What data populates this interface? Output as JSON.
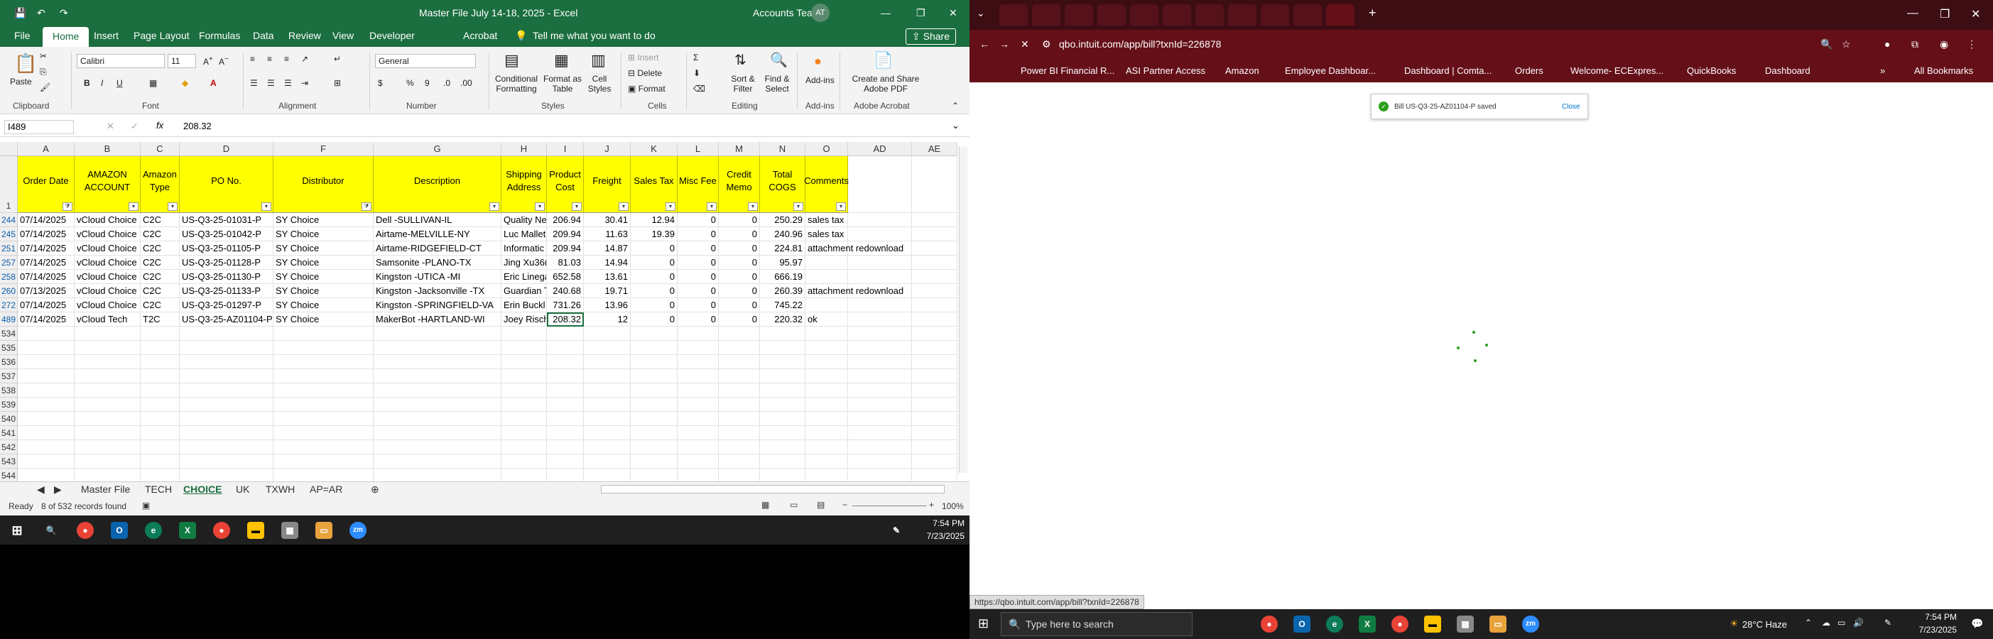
{
  "excel": {
    "title": "Master File July 14-18, 2025  -  Excel",
    "account_name": "Accounts Team",
    "account_initials": "AT",
    "menu_tabs": [
      "File",
      "Home",
      "Insert",
      "Page Layout",
      "Formulas",
      "Data",
      "Review",
      "View",
      "Developer",
      "Acrobat"
    ],
    "active_tab": "Home",
    "tell_me": "Tell me what you want to do",
    "share": "Share",
    "ribbon": {
      "paste": "Paste",
      "font_name": "Calibri",
      "font_size": "11",
      "number_format": "General",
      "conditional_formatting": "Conditional Formatting",
      "format_as_table": "Format as Table",
      "cell_styles": "Cell Styles",
      "insert": "Insert",
      "delete": "Delete",
      "format": "Format",
      "sort_filter": "Sort & Filter",
      "find_select": "Find & Select",
      "add_ins": "Add-ins",
      "create_share": "Create and Share Adobe PDF",
      "groups": [
        "Clipboard",
        "Font",
        "Alignment",
        "Number",
        "Styles",
        "Cells",
        "Editing",
        "Add-ins",
        "Adobe Acrobat"
      ]
    },
    "name_box": "I489",
    "formula_value": "208.32",
    "columns": [
      "A",
      "B",
      "C",
      "D",
      "F",
      "G",
      "H",
      "I",
      "J",
      "K",
      "L",
      "M",
      "N",
      "O",
      "AD",
      "AE"
    ],
    "headers": [
      "Order Date",
      "AMAZON ACCOUNT",
      "Amazon Type",
      "PO No.",
      "Distributor",
      "Description",
      "Shipping Address",
      "Product Cost",
      "Freight",
      "Sales Tax",
      "Misc Fee",
      "Credit Memo",
      "Total COGS",
      "Comments"
    ],
    "rows": [
      {
        "num": "244",
        "cells": [
          "07/14/2025",
          "vCloud Choice",
          "C2C",
          "US-Q3-25-01031-P",
          "SY Choice",
          "Dell -SULLIVAN-IL",
          "Quality Ne",
          "206.94",
          "30.41",
          "12.94",
          "0",
          "0",
          "250.29",
          "sales tax"
        ]
      },
      {
        "num": "245",
        "cells": [
          "07/14/2025",
          "vCloud Choice",
          "C2C",
          "US-Q3-25-01042-P",
          "SY Choice",
          "Airtame-MELVILLE-NY",
          "Luc Mallet",
          "209.94",
          "11.63",
          "19.39",
          "0",
          "0",
          "240.96",
          "sales tax"
        ]
      },
      {
        "num": "251",
        "cells": [
          "07/14/2025",
          "vCloud Choice",
          "C2C",
          "US-Q3-25-01105-P",
          "SY Choice",
          "Airtame-RIDGEFIELD-CT",
          "Informatic",
          "209.94",
          "14.87",
          "0",
          "0",
          "0",
          "224.81",
          "attachment redownload"
        ]
      },
      {
        "num": "257",
        "cells": [
          "07/14/2025",
          "vCloud Choice",
          "C2C",
          "US-Q3-25-01128-P",
          "SY Choice",
          "Samsonite -PLANO-TX",
          "Jing Xu36(",
          "81.03",
          "14.94",
          "0",
          "0",
          "0",
          "95.97",
          ""
        ]
      },
      {
        "num": "258",
        "cells": [
          "07/14/2025",
          "vCloud Choice",
          "C2C",
          "US-Q3-25-01130-P",
          "SY Choice",
          "Kingston -UTICA -MI",
          "Eric Linega",
          "652.58",
          "13.61",
          "0",
          "0",
          "0",
          "666.19",
          ""
        ]
      },
      {
        "num": "260",
        "cells": [
          "07/13/2025",
          "vCloud Choice",
          "C2C",
          "US-Q3-25-01133-P",
          "SY Choice",
          "Kingston -Jacksonville -TX",
          "Guardian T",
          "240.68",
          "19.71",
          "0",
          "0",
          "0",
          "260.39",
          "attachment redownload"
        ]
      },
      {
        "num": "272",
        "cells": [
          "07/14/2025",
          "vCloud Choice",
          "C2C",
          "US-Q3-25-01297-P",
          "SY Choice",
          "Kingston -SPRINGFIELD-VA",
          "Erin Buckl",
          "731.26",
          "13.96",
          "0",
          "0",
          "0",
          "745.22",
          ""
        ]
      },
      {
        "num": "489",
        "cells": [
          "07/14/2025",
          "vCloud Tech",
          "T2C",
          "US-Q3-25-AZ01104-P",
          "SY Choice",
          "MakerBot -HARTLAND-WI",
          "Joey Risch",
          "208.32",
          "12",
          "0",
          "0",
          "0",
          "220.32",
          "ok"
        ]
      }
    ],
    "empty_rows": [
      "534",
      "535",
      "536",
      "537",
      "538",
      "539",
      "540",
      "541",
      "542",
      "543",
      "544"
    ],
    "sheet_tabs": [
      "Master File",
      "TECH",
      "CHOICE",
      "UK",
      "TXWH",
      "AP=AR"
    ],
    "active_sheet": "CHOICE",
    "status_ready": "Ready",
    "status_records": "8 of 532 records found",
    "zoom": "100%",
    "taskbar_time": "7:54 PM",
    "taskbar_date": "7/23/2025"
  },
  "chrome": {
    "url": "qbo.intuit.com/app/bill?txnId=226878",
    "bookmarks": [
      "Power BI Financial R...",
      "ASI Partner Access",
      "Amazon",
      "Employee Dashboar...",
      "Dashboard | Comta...",
      "Orders",
      "Welcome- ECExpres...",
      "QuickBooks",
      "Dashboard"
    ],
    "all_bookmarks": "All Bookmarks",
    "toast_text": "Bill US-Q3-25-AZ01104-P saved",
    "toast_close": "Close",
    "status_url": "https://qbo.intuit.com/app/bill?txnId=226878",
    "search_placeholder": "Type here to search",
    "weather": "28°C Haze",
    "time": "7:54 PM",
    "date": "7/23/2025"
  },
  "colors": {
    "excel_green": "#1b6e3f",
    "header_yellow": "#ffff00",
    "chrome_maroon": "#651019",
    "toast_green": "#2ca01c"
  }
}
